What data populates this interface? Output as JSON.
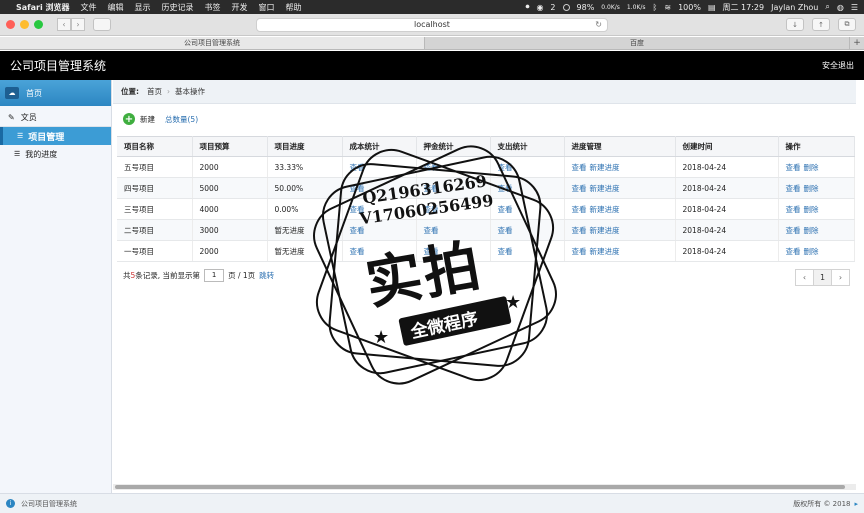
{
  "menubar": {
    "app": "Safari 浏览器",
    "items": [
      "文件",
      "编辑",
      "显示",
      "历史记录",
      "书签",
      "开发",
      "窗口",
      "帮助"
    ],
    "notif_count": "2",
    "battery_wifi": "98%",
    "net_up": "0.0K/s",
    "net_down": "1.0K/s",
    "battery": "100%",
    "clock": "周二 17:29",
    "user": "Jaylan Zhou"
  },
  "browser": {
    "url": "localhost",
    "tabs": [
      "公司项目管理系统",
      "百度"
    ]
  },
  "header": {
    "title": "公司项目管理系统",
    "logout": "安全退出"
  },
  "sidebar": {
    "home": "首页",
    "group": "文员",
    "items": [
      "项目管理",
      "我的进度"
    ]
  },
  "breadcrumb": {
    "label": "位置:",
    "home": "首页",
    "current": "基本操作"
  },
  "actions": {
    "add": "新建",
    "total": "总数量(5)"
  },
  "table": {
    "headers": [
      "项目名称",
      "项目预算",
      "项目进度",
      "成本统计",
      "押金统计",
      "支出统计",
      "进度管理",
      "创建时间",
      "操作"
    ],
    "view": "查看",
    "new_progress": "新建进度",
    "delete": "删除",
    "rows": [
      {
        "name": "五号项目",
        "budget": "2000",
        "progress": "33.33%",
        "date": "2018-04-24"
      },
      {
        "name": "四号项目",
        "budget": "5000",
        "progress": "50.00%",
        "date": "2018-04-24"
      },
      {
        "name": "三号项目",
        "budget": "4000",
        "progress": "0.00%",
        "date": "2018-04-24"
      },
      {
        "name": "二号项目",
        "budget": "3000",
        "progress": "暂无进度",
        "date": "2018-04-24"
      },
      {
        "name": "一号项目",
        "budget": "2000",
        "progress": "暂无进度",
        "date": "2018-04-24"
      }
    ]
  },
  "pager": {
    "prefix": "共",
    "count": "5",
    "mid": "条记录, 当前显示第",
    "page": "1",
    "suffix": "页 / 1页",
    "jump": "跳转",
    "prev": "‹",
    "current": "1",
    "next": "›"
  },
  "footer": {
    "left": "公司项目管理系统",
    "right": "版权所有 © 2018"
  },
  "watermark": {
    "qq": "Q2196316269",
    "wx": "V17060256499",
    "big": "实拍",
    "small": "全微程序"
  }
}
